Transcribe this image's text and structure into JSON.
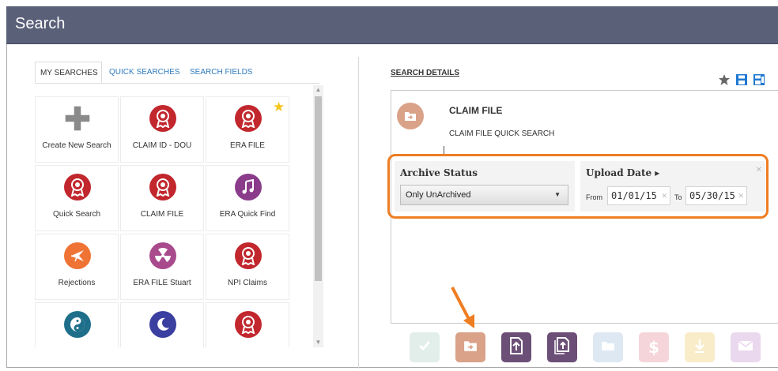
{
  "window": {
    "title": "Search"
  },
  "tabs": [
    {
      "label": "MY SEARCHES",
      "active": true
    },
    {
      "label": "QUICK SEARCHES",
      "active": false
    },
    {
      "label": "SEARCH FIELDS",
      "active": false
    }
  ],
  "searches": [
    {
      "label": "Create New Search",
      "icon": "plus-icon",
      "color": "#8a8a8a"
    },
    {
      "label": "CLAIM ID - DOU",
      "icon": "ribbon-award-icon",
      "color": "#c1272d"
    },
    {
      "label": "ERA FILE",
      "icon": "ribbon-award-icon",
      "color": "#c1272d",
      "favorite": true
    },
    {
      "label": "Quick Search",
      "icon": "ribbon-award-icon",
      "color": "#c1272d"
    },
    {
      "label": "CLAIM FILE",
      "icon": "ribbon-award-icon",
      "color": "#c1272d"
    },
    {
      "label": "ERA Quick Find",
      "icon": "music-note-icon",
      "color": "#8a3c8a"
    },
    {
      "label": "Rejections",
      "icon": "airplane-icon",
      "color": "#ef7335"
    },
    {
      "label": "ERA FILE Stuart",
      "icon": "radiation-icon",
      "color": "#a84a8c"
    },
    {
      "label": "NPI Claims",
      "icon": "ribbon-award-icon",
      "color": "#c1272d"
    },
    {
      "label": "",
      "icon": "yin-yang-icon",
      "color": "#1f6f8b"
    },
    {
      "label": "",
      "icon": "moon-icon",
      "color": "#3b3fa0"
    },
    {
      "label": "",
      "icon": "ribbon-award-icon",
      "color": "#c1272d"
    }
  ],
  "details": {
    "section_title": "SEARCH DETAILS",
    "search_name": "CLAIM FILE",
    "search_description": "CLAIM FILE QUICK SEARCH",
    "icon": "folder-arrow-icon",
    "icon_color": "#d9a289"
  },
  "filters": {
    "archive_status": {
      "label": "Archive Status",
      "value": "Only UnArchived"
    },
    "upload_date": {
      "label": "Upload Date ▸",
      "from_label": "From",
      "from_value": "01/01/15",
      "to_label": "To",
      "to_value": "05/30/15"
    }
  },
  "header_icons": [
    "star-icon",
    "save-icon",
    "save-as-icon"
  ],
  "actions": [
    {
      "name": "check-icon",
      "color": "#e2eeea"
    },
    {
      "name": "folder-arrow-icon",
      "color": "#d9a289"
    },
    {
      "name": "upload-file-icon",
      "color": "#6c4f77"
    },
    {
      "name": "upload-files-icon",
      "color": "#6c4f77"
    },
    {
      "name": "folder-icon",
      "color": "#dde8f3"
    },
    {
      "name": "dollar-icon",
      "color": "#f5d5da"
    },
    {
      "name": "download-icon",
      "color": "#f8ecc9"
    },
    {
      "name": "mail-icon",
      "color": "#ead8ee"
    }
  ],
  "colors": {
    "titlebar": "#5b6079",
    "highlight": "#ef7d22",
    "link": "#2f7bbf"
  }
}
